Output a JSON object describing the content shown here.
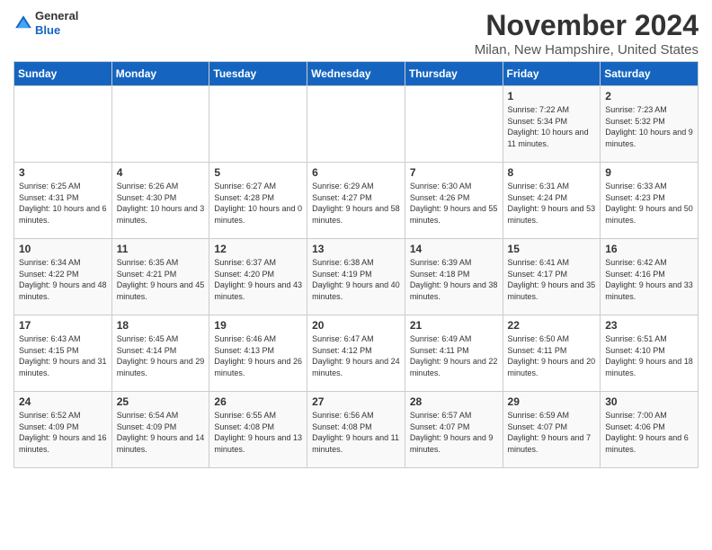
{
  "header": {
    "logo_line1": "General",
    "logo_line2": "Blue",
    "month_title": "November 2024",
    "location": "Milan, New Hampshire, United States"
  },
  "weekdays": [
    "Sunday",
    "Monday",
    "Tuesday",
    "Wednesday",
    "Thursday",
    "Friday",
    "Saturday"
  ],
  "weeks": [
    [
      {
        "day": "",
        "info": ""
      },
      {
        "day": "",
        "info": ""
      },
      {
        "day": "",
        "info": ""
      },
      {
        "day": "",
        "info": ""
      },
      {
        "day": "",
        "info": ""
      },
      {
        "day": "1",
        "info": "Sunrise: 7:22 AM\nSunset: 5:34 PM\nDaylight: 10 hours and 11 minutes."
      },
      {
        "day": "2",
        "info": "Sunrise: 7:23 AM\nSunset: 5:32 PM\nDaylight: 10 hours and 9 minutes."
      }
    ],
    [
      {
        "day": "3",
        "info": "Sunrise: 6:25 AM\nSunset: 4:31 PM\nDaylight: 10 hours and 6 minutes."
      },
      {
        "day": "4",
        "info": "Sunrise: 6:26 AM\nSunset: 4:30 PM\nDaylight: 10 hours and 3 minutes."
      },
      {
        "day": "5",
        "info": "Sunrise: 6:27 AM\nSunset: 4:28 PM\nDaylight: 10 hours and 0 minutes."
      },
      {
        "day": "6",
        "info": "Sunrise: 6:29 AM\nSunset: 4:27 PM\nDaylight: 9 hours and 58 minutes."
      },
      {
        "day": "7",
        "info": "Sunrise: 6:30 AM\nSunset: 4:26 PM\nDaylight: 9 hours and 55 minutes."
      },
      {
        "day": "8",
        "info": "Sunrise: 6:31 AM\nSunset: 4:24 PM\nDaylight: 9 hours and 53 minutes."
      },
      {
        "day": "9",
        "info": "Sunrise: 6:33 AM\nSunset: 4:23 PM\nDaylight: 9 hours and 50 minutes."
      }
    ],
    [
      {
        "day": "10",
        "info": "Sunrise: 6:34 AM\nSunset: 4:22 PM\nDaylight: 9 hours and 48 minutes."
      },
      {
        "day": "11",
        "info": "Sunrise: 6:35 AM\nSunset: 4:21 PM\nDaylight: 9 hours and 45 minutes."
      },
      {
        "day": "12",
        "info": "Sunrise: 6:37 AM\nSunset: 4:20 PM\nDaylight: 9 hours and 43 minutes."
      },
      {
        "day": "13",
        "info": "Sunrise: 6:38 AM\nSunset: 4:19 PM\nDaylight: 9 hours and 40 minutes."
      },
      {
        "day": "14",
        "info": "Sunrise: 6:39 AM\nSunset: 4:18 PM\nDaylight: 9 hours and 38 minutes."
      },
      {
        "day": "15",
        "info": "Sunrise: 6:41 AM\nSunset: 4:17 PM\nDaylight: 9 hours and 35 minutes."
      },
      {
        "day": "16",
        "info": "Sunrise: 6:42 AM\nSunset: 4:16 PM\nDaylight: 9 hours and 33 minutes."
      }
    ],
    [
      {
        "day": "17",
        "info": "Sunrise: 6:43 AM\nSunset: 4:15 PM\nDaylight: 9 hours and 31 minutes."
      },
      {
        "day": "18",
        "info": "Sunrise: 6:45 AM\nSunset: 4:14 PM\nDaylight: 9 hours and 29 minutes."
      },
      {
        "day": "19",
        "info": "Sunrise: 6:46 AM\nSunset: 4:13 PM\nDaylight: 9 hours and 26 minutes."
      },
      {
        "day": "20",
        "info": "Sunrise: 6:47 AM\nSunset: 4:12 PM\nDaylight: 9 hours and 24 minutes."
      },
      {
        "day": "21",
        "info": "Sunrise: 6:49 AM\nSunset: 4:11 PM\nDaylight: 9 hours and 22 minutes."
      },
      {
        "day": "22",
        "info": "Sunrise: 6:50 AM\nSunset: 4:11 PM\nDaylight: 9 hours and 20 minutes."
      },
      {
        "day": "23",
        "info": "Sunrise: 6:51 AM\nSunset: 4:10 PM\nDaylight: 9 hours and 18 minutes."
      }
    ],
    [
      {
        "day": "24",
        "info": "Sunrise: 6:52 AM\nSunset: 4:09 PM\nDaylight: 9 hours and 16 minutes."
      },
      {
        "day": "25",
        "info": "Sunrise: 6:54 AM\nSunset: 4:09 PM\nDaylight: 9 hours and 14 minutes."
      },
      {
        "day": "26",
        "info": "Sunrise: 6:55 AM\nSunset: 4:08 PM\nDaylight: 9 hours and 13 minutes."
      },
      {
        "day": "27",
        "info": "Sunrise: 6:56 AM\nSunset: 4:08 PM\nDaylight: 9 hours and 11 minutes."
      },
      {
        "day": "28",
        "info": "Sunrise: 6:57 AM\nSunset: 4:07 PM\nDaylight: 9 hours and 9 minutes."
      },
      {
        "day": "29",
        "info": "Sunrise: 6:59 AM\nSunset: 4:07 PM\nDaylight: 9 hours and 7 minutes."
      },
      {
        "day": "30",
        "info": "Sunrise: 7:00 AM\nSunset: 4:06 PM\nDaylight: 9 hours and 6 minutes."
      }
    ]
  ]
}
